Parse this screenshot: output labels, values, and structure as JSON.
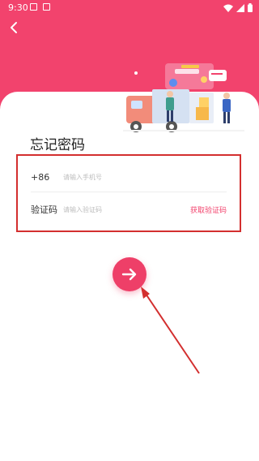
{
  "status_bar": {
    "time": "9:30"
  },
  "page": {
    "title": "忘记密码"
  },
  "form": {
    "phone": {
      "prefix": "+86",
      "placeholder": "请输入手机号",
      "value": ""
    },
    "code": {
      "label": "验证码",
      "placeholder": "请输入验证码",
      "value": "",
      "get_code_label": "获取验证码"
    }
  },
  "colors": {
    "primary": "#f2436d",
    "annotation": "#d32f2f"
  },
  "icons": {
    "back": "chevron-left-icon",
    "submit": "arrow-right-icon"
  }
}
